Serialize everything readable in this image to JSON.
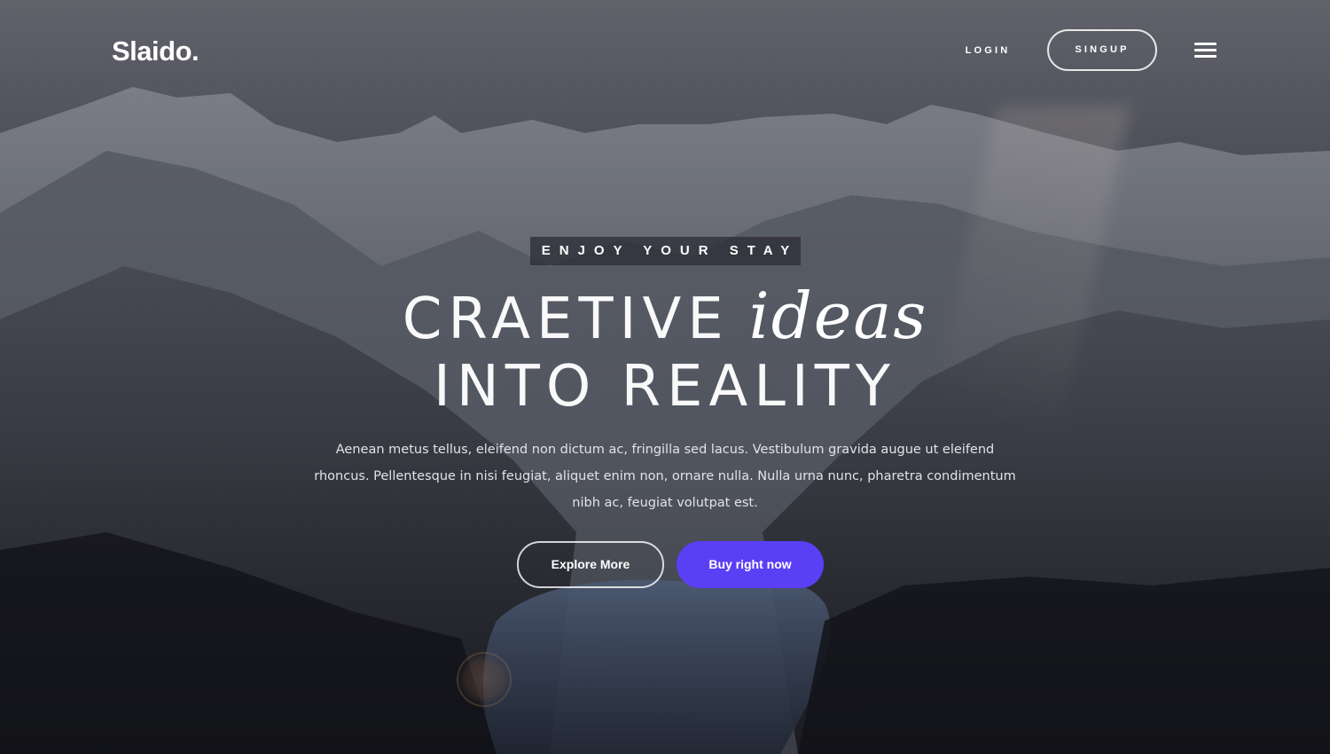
{
  "header": {
    "logo": "Slaido.",
    "login_label": "LOGIN",
    "signup_label": "SINGUP",
    "menu_icon": "hamburger-icon"
  },
  "hero": {
    "eyebrow": "ENJOY YOUR STAY",
    "headline_line1_main": "CRAETIVE",
    "headline_line1_italic": "ideas",
    "headline_line2": "INTO REALITY",
    "lead": "Aenean metus tellus, eleifend non dictum ac, fringilla sed lacus. Vestibulum gravida augue ut eleifend rhoncus. Pellentesque in nisi feugiat, aliquet enim non, ornare nulla. Nulla urna nunc, pharetra condimentum nibh ac, feugiat volutpat est.",
    "primary_button": "Explore More",
    "secondary_button": "Buy right now"
  },
  "colors": {
    "accent": "#5b3ff5",
    "text": "#ffffff"
  }
}
